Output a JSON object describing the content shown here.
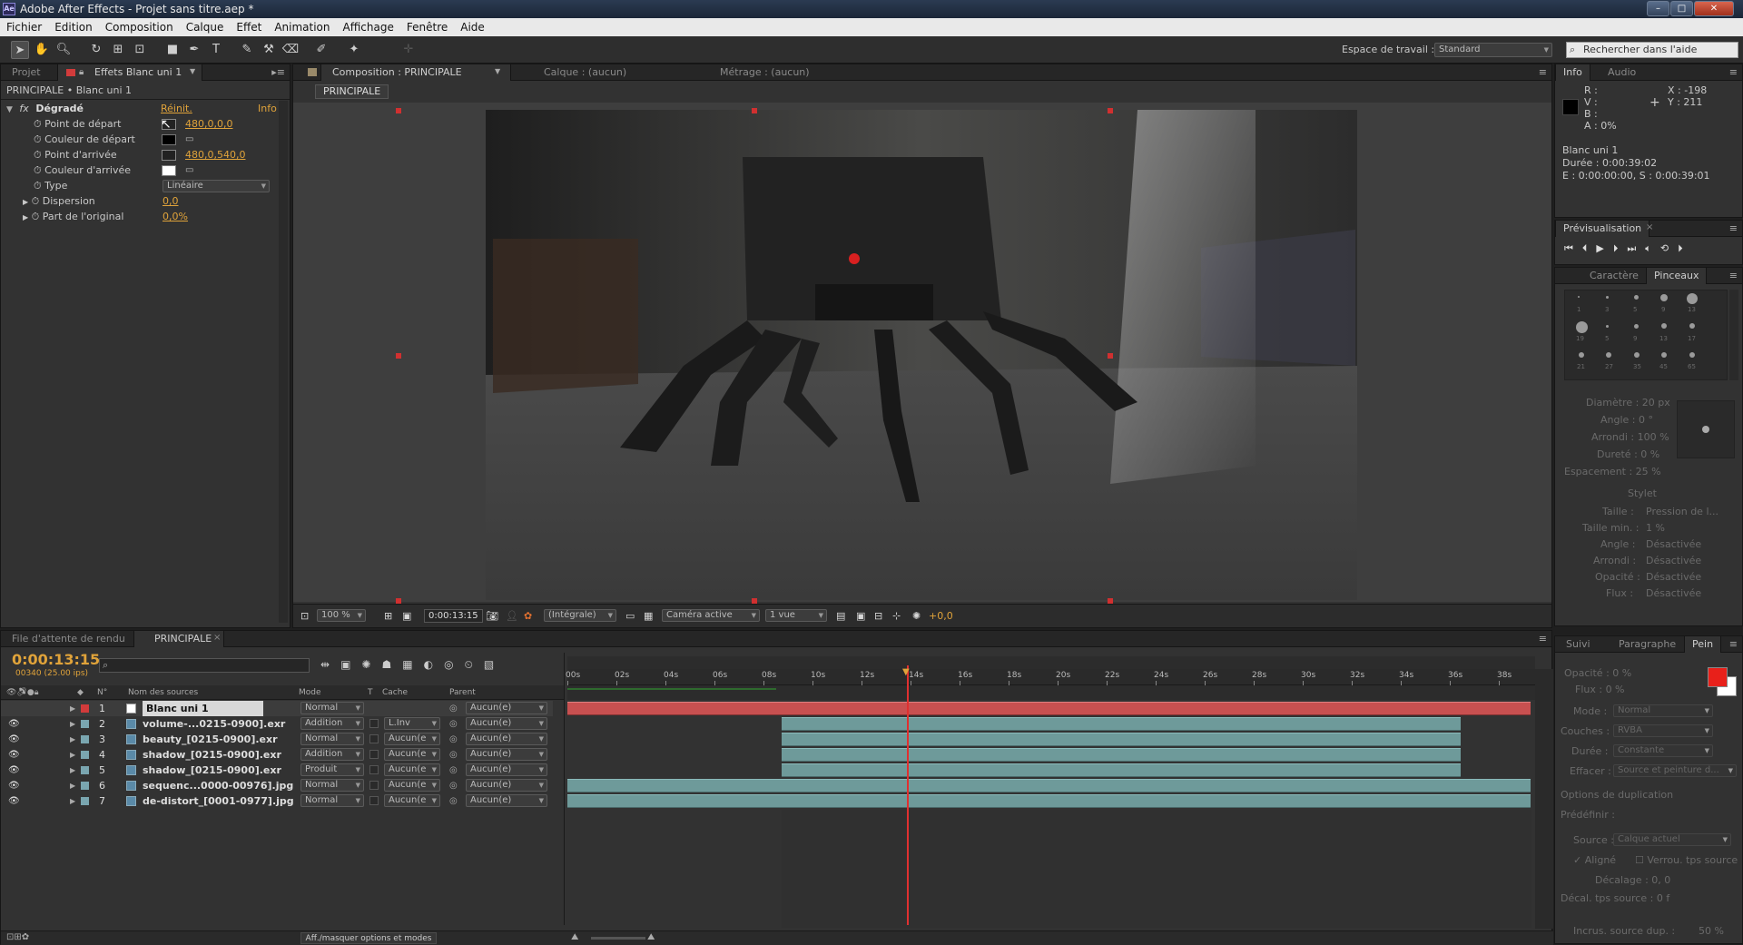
{
  "app": {
    "title": "Adobe After Effects - Projet sans titre.aep *",
    "icon_label": "Ae"
  },
  "menu": [
    "Fichier",
    "Edition",
    "Composition",
    "Calque",
    "Effet",
    "Animation",
    "Affichage",
    "Fenêtre",
    "Aide"
  ],
  "toolbar": {
    "workspace_label": "Espace de travail :",
    "workspace_value": "Standard",
    "search_placeholder": "Rechercher dans l'aide"
  },
  "effects_panel": {
    "tabs": [
      "Projet",
      "Effets Blanc uni 1"
    ],
    "breadcrumb": "PRINCIPALE • Blanc uni 1",
    "effect_name": "Dégradé",
    "reset": "Réinit.",
    "info": "Info",
    "props": [
      {
        "label": "Point de départ",
        "value": "480,0,0,0"
      },
      {
        "label": "Couleur de départ",
        "value": ""
      },
      {
        "label": "Point d'arrivée",
        "value": "480,0,540,0"
      },
      {
        "label": "Couleur d'arrivée",
        "value": ""
      },
      {
        "label": "Type",
        "value": "Linéaire"
      },
      {
        "label": "Dispersion",
        "value": "0,0"
      },
      {
        "label": "Part de l'original",
        "value": "0,0%"
      }
    ]
  },
  "comp_panel": {
    "tabs": [
      "Composition : PRINCIPALE",
      "Calque : (aucun)",
      "Métrage : (aucun)"
    ],
    "subtab": "PRINCIPALE",
    "zoom": "100 %",
    "timecode": "0:00:13:15",
    "resolution": "(Intégrale)",
    "camera": "Caméra active",
    "views": "1 vue",
    "exposure": "+0,0"
  },
  "info_panel": {
    "tabs": [
      "Info",
      "Audio"
    ],
    "rgba_labels": [
      "R :",
      "V :",
      "B :",
      "A : 0%"
    ],
    "coords": [
      "X : -198",
      "Y : 211"
    ],
    "layer": "Blanc uni 1",
    "duration": "Durée : 0:00:39:02",
    "range": "E : 0:00:00:00, S : 0:00:39:01"
  },
  "preview_panel": {
    "title": "Prévisualisation"
  },
  "brushes_panel": {
    "tabs": [
      "Caractère",
      "Pinceaux"
    ],
    "sizes": [
      "1",
      "3",
      "5",
      "9",
      "13",
      "19",
      "5",
      "9",
      "13",
      "17",
      "21",
      "27",
      "35",
      "45",
      "65"
    ],
    "diameter": "Diamètre : 20  px",
    "angle": "Angle : 0 °",
    "roundness": "Arrondi : 100 %",
    "hardness": "Dureté : 0 %",
    "spacing": "Espacement : 25 %",
    "stylus": "Stylet",
    "stylus_rows": [
      {
        "label": "Taille :",
        "value": "Pression de l..."
      },
      {
        "label": "Taille min. :",
        "value": "1 %"
      },
      {
        "label": "Angle :",
        "value": "Désactivée"
      },
      {
        "label": "Arrondi :",
        "value": "Désactivée"
      },
      {
        "label": "Opacité :",
        "value": "Désactivée"
      },
      {
        "label": "Flux :",
        "value": "Désactivée"
      }
    ]
  },
  "timeline": {
    "tabs": [
      "File d'attente de rendu",
      "PRINCIPALE"
    ],
    "timecode": "0:00:13:15",
    "frame_info": "00340 (25.00 ips)",
    "headers": {
      "num": "N°",
      "source": "Nom des sources",
      "mode": "Mode",
      "t": "T",
      "cache": "Cache",
      "parent": "Parent"
    },
    "ruler": [
      "00s",
      "02s",
      "04s",
      "06s",
      "08s",
      "10s",
      "12s",
      "14s",
      "16s",
      "18s",
      "20s",
      "22s",
      "24s",
      "26s",
      "28s",
      "30s",
      "32s",
      "34s",
      "36s",
      "38s"
    ],
    "layers": [
      {
        "num": "1",
        "name": "Blanc uni 1",
        "mode": "Normal",
        "cache": "",
        "parent": "Aucun(e)"
      },
      {
        "num": "2",
        "name": "volume-...0215-0900].exr",
        "mode": "Addition",
        "cache": "L.Inv",
        "parent": "Aucun(e)"
      },
      {
        "num": "3",
        "name": "beauty_[0215-0900].exr",
        "mode": "Normal",
        "cache": "Aucun(e",
        "parent": "Aucun(e)"
      },
      {
        "num": "4",
        "name": "shadow_[0215-0900].exr",
        "mode": "Addition",
        "cache": "Aucun(e",
        "parent": "Aucun(e)"
      },
      {
        "num": "5",
        "name": "shadow_[0215-0900].exr",
        "mode": "Produit",
        "cache": "Aucun(e",
        "parent": "Aucun(e)"
      },
      {
        "num": "6",
        "name": "sequenc...0000-00976].jpg",
        "mode": "Normal",
        "cache": "Aucun(e",
        "parent": "Aucun(e)"
      },
      {
        "num": "7",
        "name": "de-distort_[0001-0977].jpg",
        "mode": "Normal",
        "cache": "Aucun(e",
        "parent": "Aucun(e)"
      }
    ],
    "bottom_toggle": "Aff./masquer options et modes",
    "colors": {
      "solid_bar": "#c85050",
      "footage_bar": "#6e9a9a",
      "playhead": "#e03030"
    }
  },
  "paint_panel": {
    "tabs": [
      "Suivi",
      "Paragraphe",
      "Pein"
    ],
    "opacity": "Opacité : 0 %",
    "flow": "Flux : 0 %",
    "mode_label": "Mode :",
    "mode_value": "Normal",
    "channels_label": "Couches :",
    "channels_value": "RVBA",
    "duration_label": "Durée :",
    "duration_value": "Constante",
    "erase_label": "Effacer :",
    "erase_value": "Source et peinture d...",
    "dup_title": "Options de duplication",
    "preset": "Prédéfinir :",
    "source_label": "Source :",
    "source_value": "Calque actuel",
    "aligned": "Aligné",
    "lock_time": "Verrou. tps source",
    "offset": "Décalage :  0,        0",
    "time_offset": "Décal. tps source :  0  f",
    "incr": "Incrus. source dup. :",
    "incr_value": "50 %",
    "fg_color": "#e8201a",
    "bg_color": "#ffffff"
  }
}
